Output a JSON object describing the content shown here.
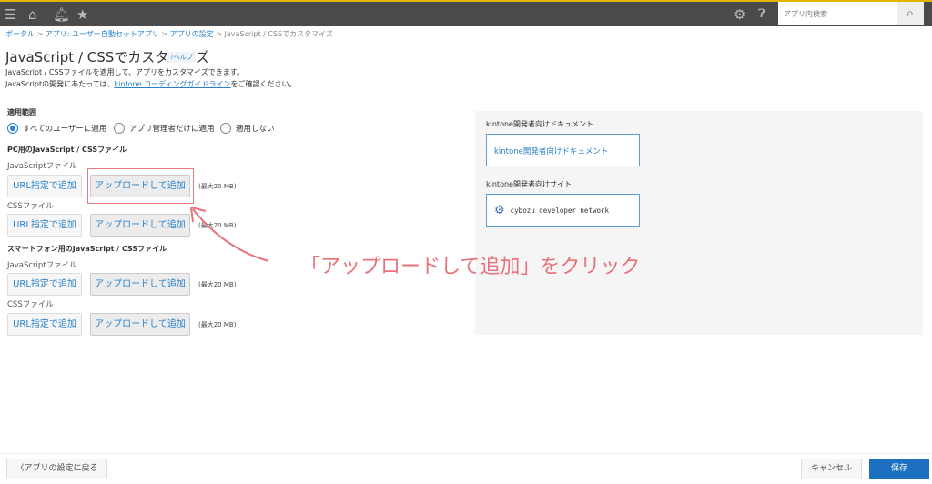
{
  "header": {
    "search_placeholder": "アプリ内検索"
  },
  "breadcrumb": {
    "portal": "ポータル",
    "app": "アプリ: ユーザー自動セットアプリ",
    "settings": "アプリの設定",
    "current": "JavaScript / CSSでカスタマイズ",
    "sep": ">"
  },
  "page": {
    "title": "JavaScript / CSSでカスタマイズ",
    "help": "?ヘルプ",
    "desc1": "JavaScript / CSSファイルを適用して、アプリをカスタマイズできます。",
    "desc2_pre": "JavaScriptの開発にあたっては、",
    "desc2_link": "kintone コーディングガイドライン",
    "desc2_post": "をご確認ください。"
  },
  "scope": {
    "label": "適用範囲",
    "options": [
      "すべてのユーザーに適用",
      "アプリ管理者だけに適用",
      "適用しない"
    ],
    "selected": 0
  },
  "pc": {
    "heading": "PC用のJavaScript / CSSファイル",
    "js_label": "JavaScriptファイル",
    "css_label": "CSSファイル"
  },
  "mobile": {
    "heading": "スマートフォン用のJavaScript / CSSファイル",
    "js_label": "JavaScriptファイル",
    "css_label": "CSSファイル"
  },
  "buttons": {
    "url": "URL指定で追加",
    "upload": "アップロードして追加",
    "limit": "(最大20 MB)"
  },
  "panel": {
    "doc_label": "kintone開発者向けドキュメント",
    "doc_link": "kintone開発者向けドキュメント",
    "site_label": "kintone開発者向けサイト",
    "site_link": "cybozu developer network"
  },
  "annotation": "「アップロードして追加」をクリック",
  "footer": {
    "back": "アプリの設定に戻る",
    "cancel": "キャンセル",
    "save": "保存"
  },
  "colors": {
    "accent": "#2a80c8",
    "save": "#1d6fc0",
    "annotation": "#e8727a"
  }
}
